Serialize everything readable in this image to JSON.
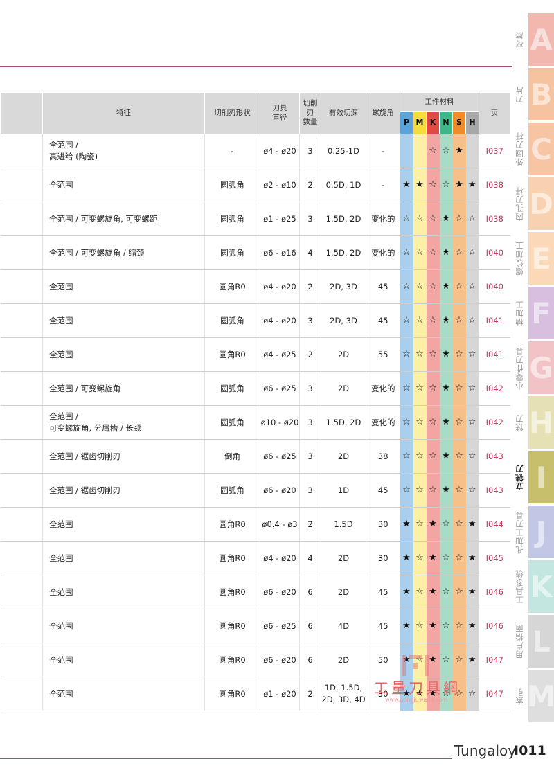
{
  "header": {
    "feature": "特征",
    "shape": "切削刃形状",
    "diameter": "刀具\n直径",
    "flutes": "切削刃\n数量",
    "depth": "有效切深",
    "helix": "螺旋角",
    "material_group": "工件材料",
    "page": "页",
    "materials": [
      {
        "letter": "P",
        "color": "#a9cfec"
      },
      {
        "letter": "M",
        "color": "#fbf0a6"
      },
      {
        "letter": "K",
        "color": "#f2a6a3"
      },
      {
        "letter": "N",
        "color": "#a8dcc6"
      },
      {
        "letter": "S",
        "color": "#f6c08b"
      },
      {
        "letter": "H",
        "color": "#d6d6d6"
      }
    ],
    "material_header_colors": [
      "#5aa4d9",
      "#f3dc3c",
      "#e04a44",
      "#3fb58a",
      "#ef8b2b",
      "#a8a8a8"
    ]
  },
  "rows": [
    {
      "feature": "全范围 /\n高进给 (陶瓷)",
      "shape": "-",
      "diameter": "ø4 - ø20",
      "flutes": "3",
      "depth": "0.25-1D",
      "helix": "-",
      "mats": [
        "",
        "",
        "☆",
        "☆",
        "★",
        ""
      ],
      "page": "I037"
    },
    {
      "feature": "全范围",
      "shape": "圆弧角",
      "diameter": "ø2 - ø10",
      "flutes": "2",
      "depth": "0.5D, 1D",
      "helix": "-",
      "mats": [
        "★",
        "★",
        "☆",
        "☆",
        "★",
        "★"
      ],
      "page": "I038"
    },
    {
      "feature": "全范围 / 可变螺旋角, 可变螺距",
      "shape": "圆弧角",
      "diameter": "ø1 - ø25",
      "flutes": "3",
      "depth": "1.5D, 2D",
      "helix": "变化的",
      "mats": [
        "☆",
        "☆",
        "☆",
        "★",
        "☆",
        "☆"
      ],
      "page": "I038"
    },
    {
      "feature": "全范围 / 可变螺旋角 / 缩颈",
      "shape": "圆弧角",
      "diameter": "ø6 - ø16",
      "flutes": "4",
      "depth": "1.5D, 2D",
      "helix": "变化的",
      "mats": [
        "☆",
        "☆",
        "☆",
        "★",
        "☆",
        "☆"
      ],
      "page": "I040"
    },
    {
      "feature": "全范围",
      "shape": "圆角R0",
      "diameter": "ø4 - ø20",
      "flutes": "2",
      "depth": "2D, 3D",
      "helix": "45",
      "mats": [
        "☆",
        "☆",
        "☆",
        "★",
        "☆",
        "☆"
      ],
      "page": "I040"
    },
    {
      "feature": "全范围",
      "shape": "圆弧角",
      "diameter": "ø4 - ø20",
      "flutes": "3",
      "depth": "2D, 3D",
      "helix": "45",
      "mats": [
        "☆",
        "☆",
        "☆",
        "★",
        "☆",
        "☆"
      ],
      "page": "I041"
    },
    {
      "feature": "全范围",
      "shape": "圆角R0",
      "diameter": "ø4 - ø25",
      "flutes": "2",
      "depth": "2D",
      "helix": "55",
      "mats": [
        "☆",
        "☆",
        "☆",
        "★",
        "☆",
        "☆"
      ],
      "page": "I041"
    },
    {
      "feature": "全范围 / 可变螺旋角",
      "shape": "圆弧角",
      "diameter": "ø6 - ø25",
      "flutes": "3",
      "depth": "2D",
      "helix": "变化的",
      "mats": [
        "☆",
        "☆",
        "☆",
        "★",
        "☆",
        "☆"
      ],
      "page": "I042"
    },
    {
      "feature": "全范围 /\n可变螺旋角, 分屑槽 / 长颈",
      "shape": "圆弧角",
      "diameter": "ø10 - ø20",
      "flutes": "3",
      "depth": "1.5D, 2D",
      "helix": "变化的",
      "mats": [
        "☆",
        "☆",
        "☆",
        "★",
        "☆",
        "☆"
      ],
      "page": "I042"
    },
    {
      "feature": "全范围 / 锯齿切削刃",
      "shape": "倒角",
      "diameter": "ø6 - ø25",
      "flutes": "3",
      "depth": "2D",
      "helix": "38",
      "mats": [
        "☆",
        "☆",
        "☆",
        "★",
        "☆",
        "☆"
      ],
      "page": "I043"
    },
    {
      "feature": "全范围 / 锯齿切削刃",
      "shape": "圆弧角",
      "diameter": "ø6 - ø20",
      "flutes": "3",
      "depth": "1D",
      "helix": "45",
      "mats": [
        "☆",
        "☆",
        "☆",
        "★",
        "☆",
        "☆"
      ],
      "page": "I043"
    },
    {
      "feature": "全范围",
      "shape": "圆角R0",
      "diameter": "ø0.4 - ø3",
      "flutes": "2",
      "depth": "1.5D",
      "helix": "30",
      "mats": [
        "★",
        "☆",
        "★",
        "☆",
        "☆",
        "★"
      ],
      "page": "I044"
    },
    {
      "feature": "全范围",
      "shape": "圆角R0",
      "diameter": "ø4 - ø20",
      "flutes": "4",
      "depth": "2D",
      "helix": "30",
      "mats": [
        "★",
        "☆",
        "★",
        "☆",
        "☆",
        "★"
      ],
      "page": "I045"
    },
    {
      "feature": "全范围",
      "shape": "圆角R0",
      "diameter": "ø6 - ø20",
      "flutes": "6",
      "depth": "2D",
      "helix": "45",
      "mats": [
        "★",
        "☆",
        "★",
        "☆",
        "☆",
        "★"
      ],
      "page": "I046"
    },
    {
      "feature": "全范围",
      "shape": "圆角R0",
      "diameter": "ø6 - ø25",
      "flutes": "6",
      "depth": "4D",
      "helix": "45",
      "mats": [
        "★",
        "☆",
        "★",
        "☆",
        "☆",
        "★"
      ],
      "page": "I046"
    },
    {
      "feature": "全范围",
      "shape": "圆角R0",
      "diameter": "ø6 - ø20",
      "flutes": "6",
      "depth": "2D",
      "helix": "50",
      "mats": [
        "★",
        "☆",
        "★",
        "☆",
        "☆",
        "★"
      ],
      "page": "I047"
    },
    {
      "feature": "全范围",
      "shape": "圆角R0",
      "diameter": "ø1 - ø20",
      "flutes": "2",
      "depth": "1D, 1.5D,\n2D, 3D, 4D",
      "helix": "30",
      "mats": [
        "★",
        "★",
        "★",
        "☆",
        "☆",
        "☆"
      ],
      "page": "I047"
    }
  ],
  "tabs": [
    {
      "letter": "A",
      "label": "材质",
      "color": "#f2b8b0"
    },
    {
      "letter": "B",
      "label": "刀片",
      "color": "#f6c3a0"
    },
    {
      "letter": "C",
      "label": "外圆刀杆",
      "color": "#f7c4a4"
    },
    {
      "letter": "D",
      "label": "内孔刀杆",
      "color": "#f8d2b0"
    },
    {
      "letter": "E",
      "label": "螺纹加工",
      "color": "#fbd9b8"
    },
    {
      "letter": "F",
      "label": "槽加工",
      "color": "#d8bedf"
    },
    {
      "letter": "G",
      "label": "小零件刀具",
      "color": "#f2c3c6"
    },
    {
      "letter": "H",
      "label": "铣刀",
      "color": "#e6e1b5"
    },
    {
      "letter": "I",
      "label": "立铣刀",
      "color": "#c7bf6c"
    },
    {
      "letter": "J",
      "label": "孔加工刀具",
      "color": "#c2c7e6"
    },
    {
      "letter": "K",
      "label": "工具系统",
      "color": "#c4e6e0"
    },
    {
      "letter": "L",
      "label": "用户指南",
      "color": "#d6d6d6"
    },
    {
      "letter": "M",
      "label": "索引",
      "color": "#dedede"
    }
  ],
  "active_tab": "I",
  "footer": {
    "brand": "Tungaloy",
    "page_number": "I011"
  },
  "watermark": {
    "text": "工量刀具網",
    "url": "www.gongjuwang.com"
  }
}
